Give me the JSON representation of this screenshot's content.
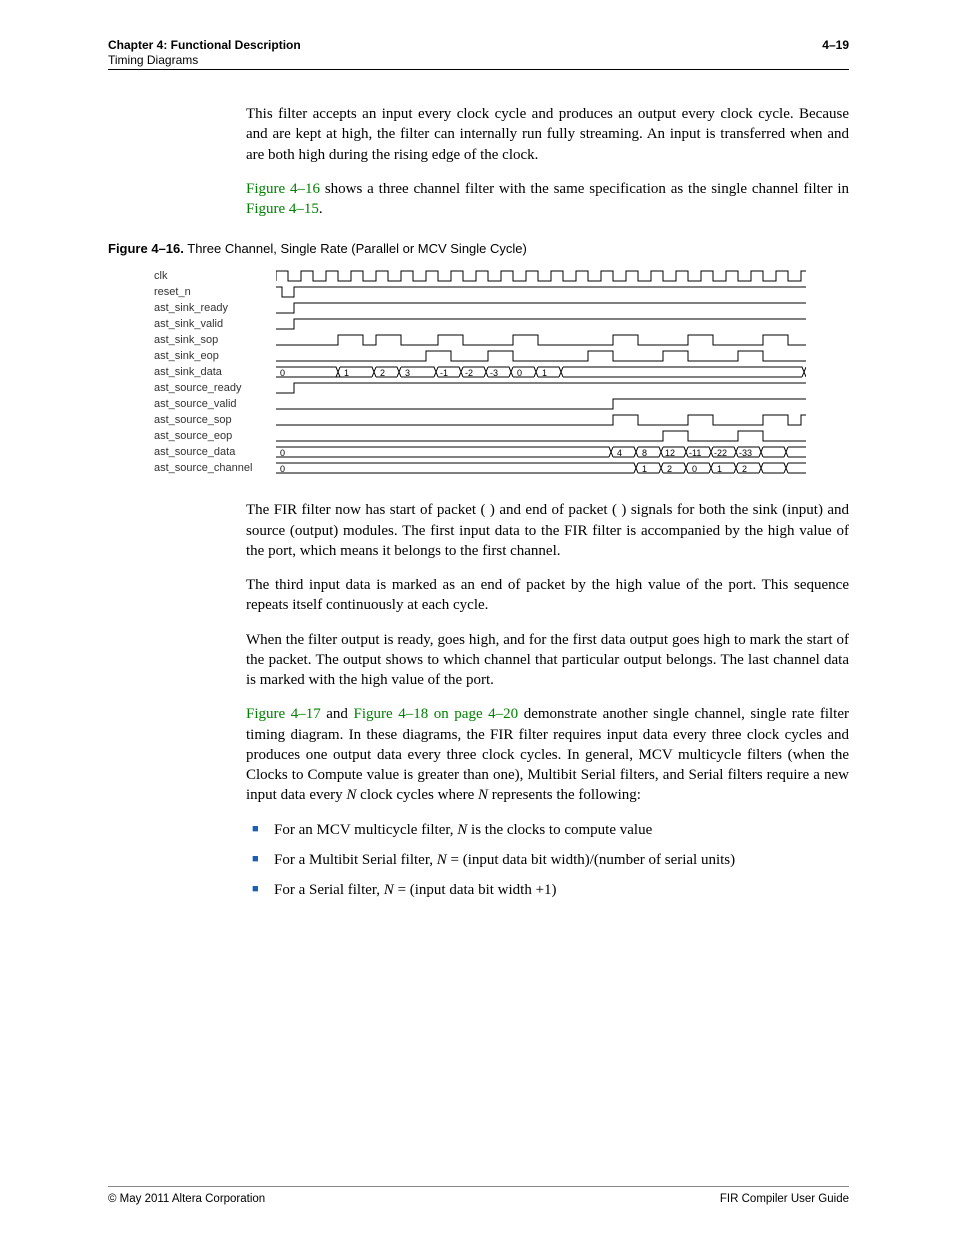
{
  "header": {
    "chapter": "Chapter 4:  Functional Description",
    "section": "Timing Diagrams",
    "pagenum": "4–19"
  },
  "para1": {
    "t1": "This filter accepts an input every clock cycle and produces an output every clock cycle. Because ",
    "t2": " and ",
    "t3": " are kept at high, the filter can internally run fully streaming. An input is transferred when ",
    "t4": " and ",
    "t5": " are both high during the rising edge of the clock."
  },
  "para2": {
    "t1": "Figure 4–16",
    "t2": " shows a three channel filter with the same specification as the single channel filter in ",
    "t3": "Figure 4–15",
    "t4": "."
  },
  "figcap": {
    "num": "Figure 4–16.",
    "title": " Three Channel, Single Rate (Parallel or MCV Single Cycle)"
  },
  "signals": [
    "clk",
    "reset_n",
    "ast_sink_ready",
    "ast_sink_valid",
    "ast_sink_sop",
    "ast_sink_eop",
    "ast_sink_data",
    "ast_source_ready",
    "ast_source_valid",
    "ast_source_sop",
    "ast_source_eop",
    "ast_source_data",
    "ast_source_channel"
  ],
  "sink_data_values": [
    "0",
    "1",
    "2",
    "3",
    "-1",
    "-2",
    "-3",
    "0",
    "1"
  ],
  "source_data_values": [
    "0",
    "4",
    "8",
    "12",
    "-11",
    "-22",
    "-33"
  ],
  "source_channel_values": [
    "0",
    "1",
    "2",
    "0",
    "1",
    "2"
  ],
  "para3": {
    "t1": "The FIR filter now has start of packet (",
    "t2": ") and end of packet (",
    "t3": ") signals for both the sink (input) and source (output) modules. The first input data to the FIR filter is accompanied by the high value of the ",
    "t4": " port, which means it belongs to the first channel."
  },
  "para4": {
    "t1": "The third input data is marked as an end of packet by the high value of the ",
    "t2": " port. This sequence repeats itself continuously at each cycle."
  },
  "para5": {
    "t1": "When the filter output is ready, ",
    "t2": " goes high, and for the first data output ",
    "t3": " goes high to mark the start of the packet. The ",
    "t4": " output shows to which channel that particular output belongs. The last channel data is marked with the high value of the ",
    "t5": " port."
  },
  "para6": {
    "t1": "Figure 4–17",
    "t2": " and ",
    "t3": "Figure 4–18 on page 4–20",
    "t4": " demonstrate another single channel, single rate filter timing diagram. In these diagrams, the FIR filter requires input data every three clock cycles and produces one output data every three clock cycles. In general, MCV multicycle filters (when the Clocks to Compute value is greater than one), Multibit Serial filters, and Serial filters require a new input data every ",
    "t5": "N",
    "t6": " clock cycles where ",
    "t7": "N",
    "t8": " represents the following:"
  },
  "bullets": {
    "b1a": "For an MCV multicycle filter, ",
    "b1b": "N",
    "b1c": " is the clocks to compute value",
    "b2a": "For a Multibit Serial filter, ",
    "b2b": "N",
    "b2c": " = (input data bit width)/(number of serial units)",
    "b3a": "For a Serial filter, ",
    "b3b": "N",
    "b3c": " = (input data bit width +1)"
  },
  "footer": {
    "left": "© May 2011   Altera Corporation",
    "right": "FIR Compiler User Guide"
  }
}
